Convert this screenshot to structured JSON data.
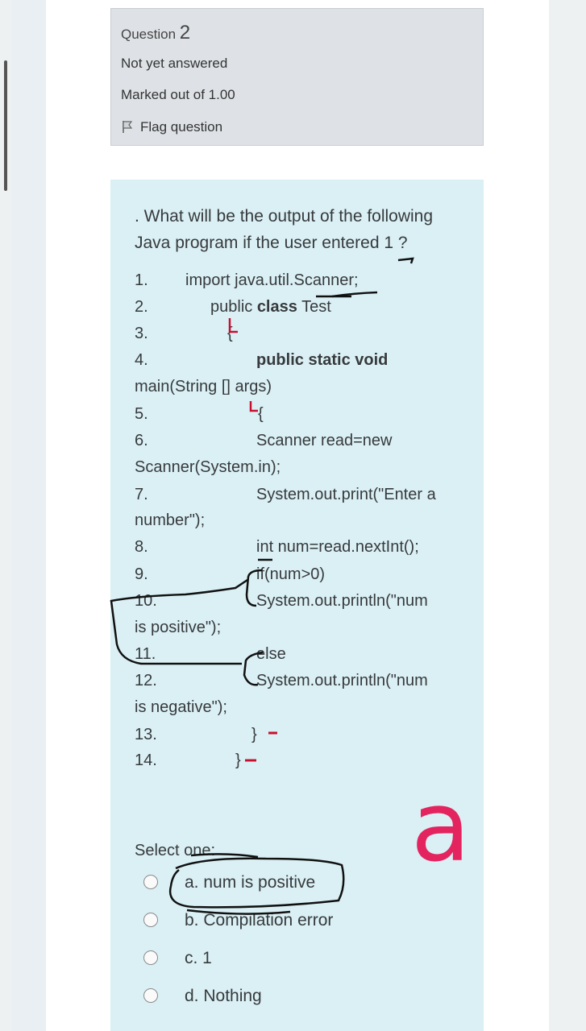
{
  "question_info": {
    "label": "Question",
    "number": "2",
    "state": "Not yet answered",
    "marks": "Marked out of 1.00",
    "flag_label": "Flag question"
  },
  "question": {
    "text_line1": ". What will be the output of the following",
    "text_line2": "Java program if the user entered 1 ?",
    "code_lines": [
      {
        "n": "1.",
        "t": "import java.util.Scanner;"
      },
      {
        "n": "2.",
        "t_a": "public ",
        "t_b": "class",
        "t_c": " Test"
      },
      {
        "n": "3.",
        "t": "{"
      },
      {
        "n": "4.",
        "t": "public static void",
        "cont": "main(String [] args)"
      },
      {
        "n": "5.",
        "t": "{"
      },
      {
        "n": "6.",
        "t": "Scanner read=new",
        "cont": "Scanner(System.in);"
      },
      {
        "n": "7.",
        "t": "System.out.print(\"Enter a",
        "cont": "number\");"
      },
      {
        "n": "8.",
        "t": "int num=read.nextInt();"
      },
      {
        "n": "9.",
        "t": "if(num>0)"
      },
      {
        "n": "10.",
        "t": "System.out.println(\"num",
        "cont": "is positive\");"
      },
      {
        "n": "11.",
        "t": "else"
      },
      {
        "n": "12.",
        "t": "System.out.println(\"num",
        "cont": "is negative\");"
      },
      {
        "n": "13.",
        "t": "}"
      },
      {
        "n": "14.",
        "t": "}"
      }
    ]
  },
  "answer": {
    "prompt": "Select one:",
    "options": [
      {
        "label": "a. num is positive",
        "selected": false
      },
      {
        "label": "b. Compilation error",
        "selected": false
      },
      {
        "label": "c. 1",
        "selected": false
      },
      {
        "label": "d. Nothing",
        "selected": false
      }
    ]
  },
  "handwriting": {
    "answer_letter": "a"
  },
  "colors": {
    "info_bg": "#dee2e6",
    "content_bg": "#daf0f5",
    "ink_black": "#111111",
    "ink_red": "#c8102e",
    "ink_pink": "#e3245f"
  }
}
